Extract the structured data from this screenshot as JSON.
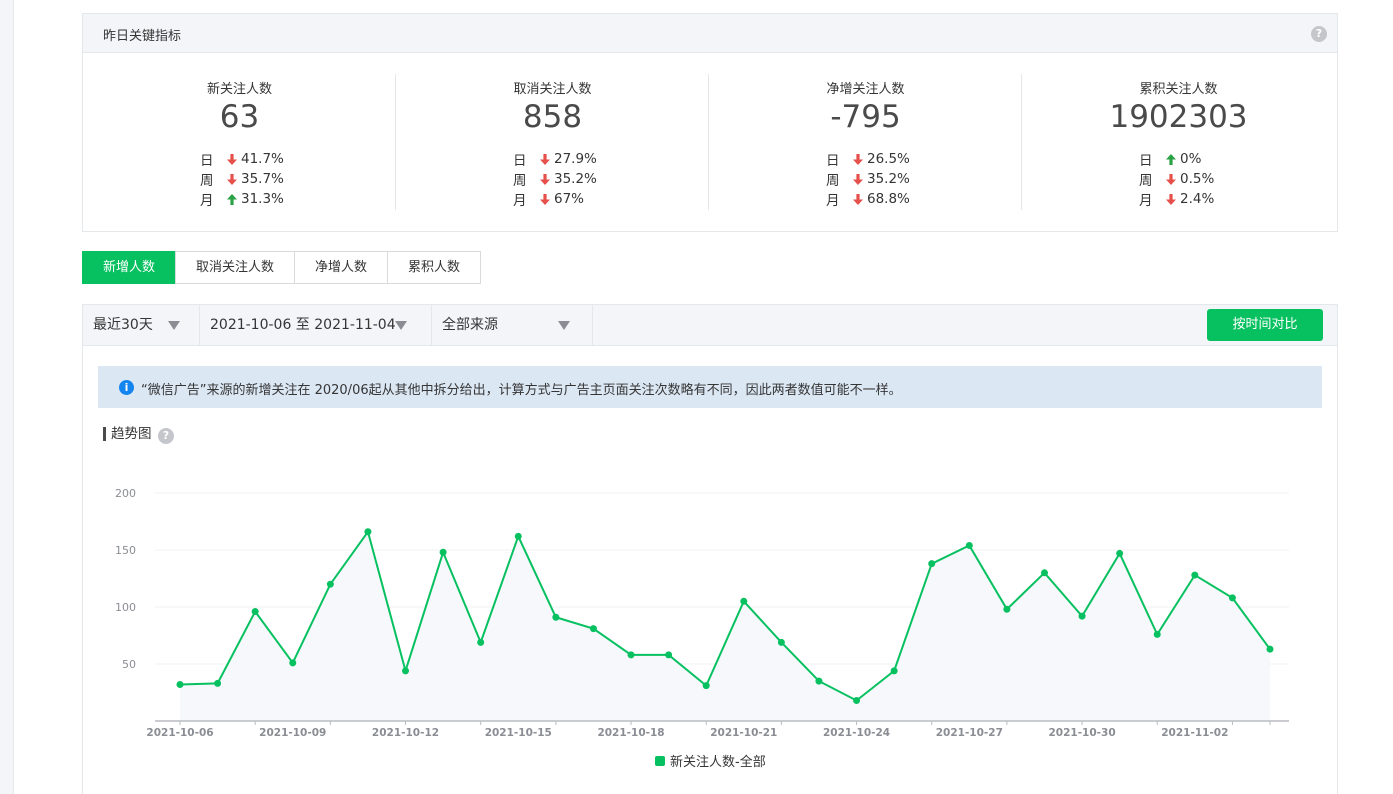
{
  "kpi": {
    "title": "昨日关键指标",
    "help": "?",
    "cards": [
      {
        "label": "新关注人数",
        "value": "63",
        "rows": [
          {
            "period": "日",
            "dir": "down",
            "pct": "41.7%"
          },
          {
            "period": "周",
            "dir": "down",
            "pct": "35.7%"
          },
          {
            "period": "月",
            "dir": "up",
            "pct": "31.3%"
          }
        ]
      },
      {
        "label": "取消关注人数",
        "value": "858",
        "rows": [
          {
            "period": "日",
            "dir": "down",
            "pct": "27.9%"
          },
          {
            "period": "周",
            "dir": "down",
            "pct": "35.2%"
          },
          {
            "period": "月",
            "dir": "down",
            "pct": "67%"
          }
        ]
      },
      {
        "label": "净增关注人数",
        "value": "-795",
        "rows": [
          {
            "period": "日",
            "dir": "down",
            "pct": "26.5%"
          },
          {
            "period": "周",
            "dir": "down",
            "pct": "35.2%"
          },
          {
            "period": "月",
            "dir": "down",
            "pct": "68.8%"
          }
        ]
      },
      {
        "label": "累积关注人数",
        "value": "1902303",
        "rows": [
          {
            "period": "日",
            "dir": "up",
            "pct": "0%"
          },
          {
            "period": "周",
            "dir": "down",
            "pct": "0.5%"
          },
          {
            "period": "月",
            "dir": "down",
            "pct": "2.4%"
          }
        ]
      }
    ]
  },
  "tabs": [
    "新增人数",
    "取消关注人数",
    "净增人数",
    "累积人数"
  ],
  "active_tab": "新增人数",
  "filters": {
    "range": "最近30天",
    "dates": "2021-10-06 至 2021-11-04",
    "source": "全部来源",
    "compare_button": "按时间对比"
  },
  "notice": {
    "info_icon": "i",
    "text": "“微信广告”来源的新增关注在 2020/06起从其他中拆分给出，计算方式与广告主页面关注次数略有不同，因此两者数值可能不一样。"
  },
  "trend": {
    "title": "趋势图",
    "help": "?"
  },
  "colors": {
    "accent": "#07c160",
    "down": "#e5504b",
    "up": "#2ba245",
    "info": "#1485ee"
  },
  "chart_data": {
    "type": "line",
    "x": [
      "2021-10-06",
      "2021-10-07",
      "2021-10-08",
      "2021-10-09",
      "2021-10-10",
      "2021-10-11",
      "2021-10-12",
      "2021-10-13",
      "2021-10-14",
      "2021-10-15",
      "2021-10-16",
      "2021-10-17",
      "2021-10-18",
      "2021-10-19",
      "2021-10-20",
      "2021-10-21",
      "2021-10-22",
      "2021-10-23",
      "2021-10-24",
      "2021-10-25",
      "2021-10-26",
      "2021-10-27",
      "2021-10-28",
      "2021-10-29",
      "2021-10-30",
      "2021-10-31",
      "2021-11-01",
      "2021-11-02",
      "2021-11-03",
      "2021-11-04"
    ],
    "x_tick_labels": [
      "2021-10-06",
      "2021-10-09",
      "2021-10-12",
      "2021-10-15",
      "2021-10-18",
      "2021-10-21",
      "2021-10-24",
      "2021-10-27",
      "2021-10-30",
      "2021-11-02"
    ],
    "series": [
      {
        "name": "新关注人数-全部",
        "values": [
          32,
          33,
          96,
          51,
          120,
          166,
          44,
          148,
          69,
          162,
          91,
          81,
          58,
          58,
          31,
          105,
          69,
          35,
          18,
          44,
          138,
          154,
          98,
          130,
          92,
          147,
          76,
          128,
          108,
          63
        ]
      }
    ],
    "yticks": [
      50,
      100,
      150,
      200
    ],
    "ylim": [
      0,
      200
    ],
    "grid": true,
    "legend": "bottom-center"
  }
}
